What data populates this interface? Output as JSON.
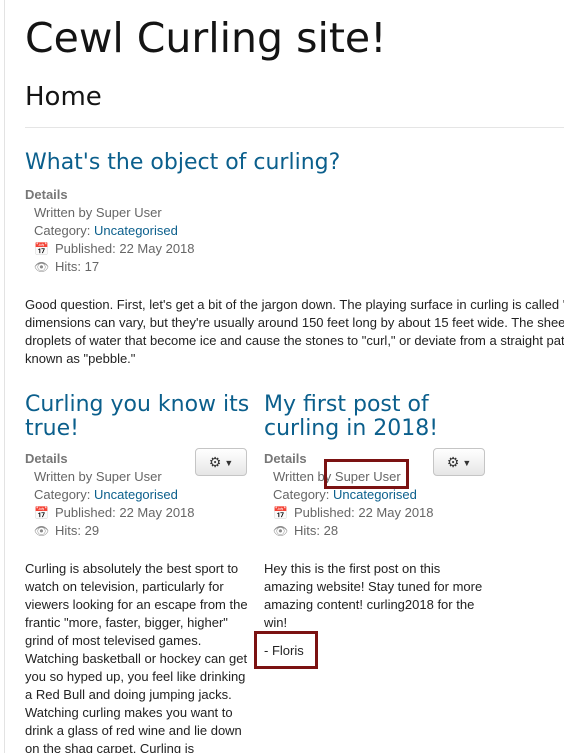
{
  "site": {
    "title": "Cewl Curling site!",
    "page_heading": "Home"
  },
  "labels": {
    "details": "Details",
    "written_by": "Written by",
    "category": "Category:",
    "published": "Published:",
    "hits": "Hits:"
  },
  "articles": [
    {
      "title": "What's the object of curling?",
      "author": "Super User",
      "category": "Uncategorised",
      "published": "22 May 2018",
      "hits": "17",
      "body": [
        "Good question. First, let's get a bit of the jargon down. The playing surface in curling is called '",
        "dimensions can vary, but they're usually around 150 feet long by about 15 feet wide. The shee",
        "droplets of water that become ice and cause the stones to \"curl,\" or deviate from a straight pat",
        "known as \"pebble.\""
      ]
    },
    {
      "title": "Curling you know its true!",
      "author": "Super User",
      "category": "Uncategorised",
      "published": "22 May 2018",
      "hits": "29",
      "body": "Curling is absolutely the best sport to watch on television, particularly for viewers looking for an escape from the frantic \"more, faster, bigger, higher\" grind of most televised games. Watching basketball or hockey can get you so hyped up, you feel like drinking a Red Bull and doing jumping jacks. Watching curling makes you want to drink a glass of red wine and lie down on the shag carpet. Curling is"
    },
    {
      "title": "My first post of curling in 2018!",
      "author": "Super User",
      "category": "Uncategorised",
      "published": "22 May 2018",
      "hits": "28",
      "body": "Hey this is the first post on this amazing website! Stay tuned for more amazing content! curling2018 for the win!",
      "signature": "- Floris"
    }
  ],
  "icons": {
    "gear": "gear-icon",
    "caret": "caret-down-icon",
    "calendar": "calendar-icon",
    "eye": "eye-icon"
  },
  "colors": {
    "link": "#0b5f8c",
    "highlight": "#7b1212"
  }
}
